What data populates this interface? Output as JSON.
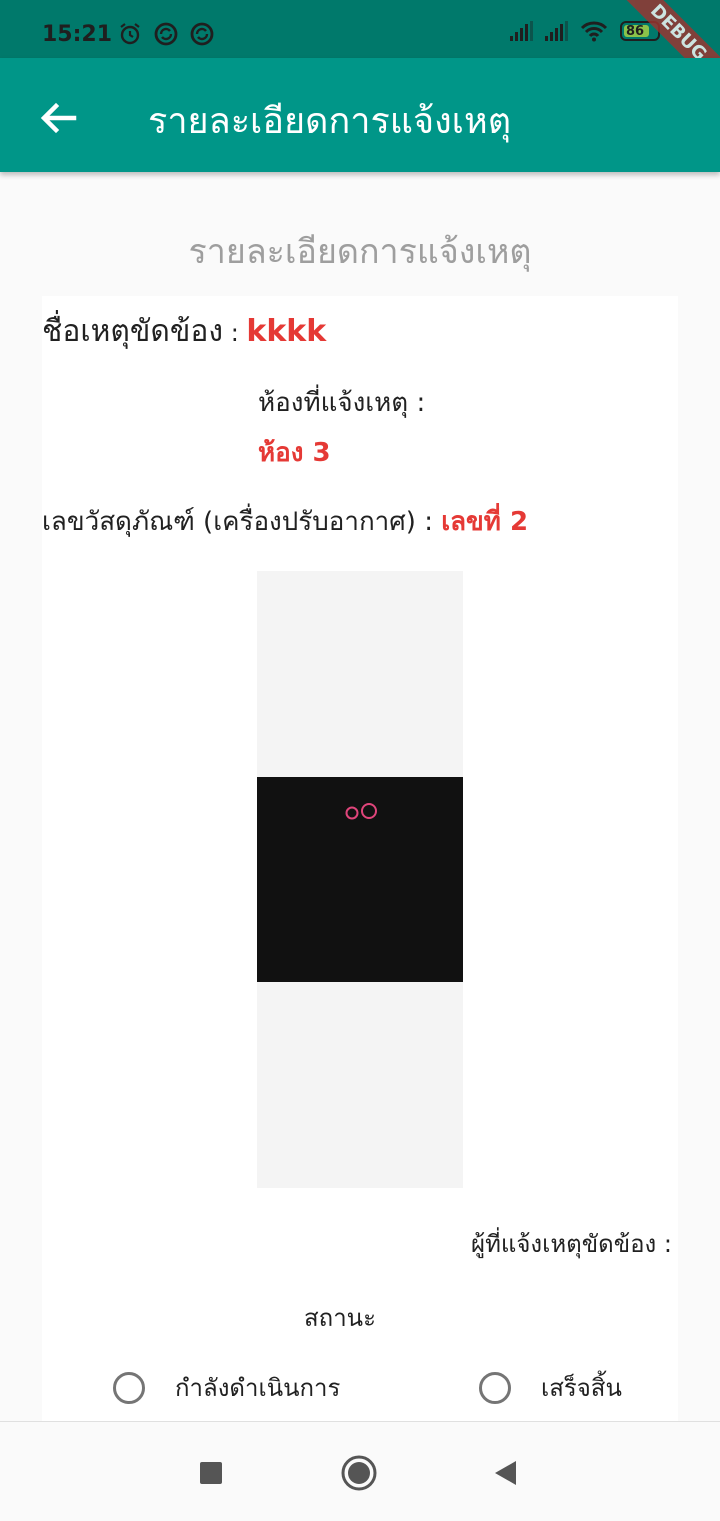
{
  "status_bar": {
    "time": "15:21",
    "icons_left": [
      "alarm-icon",
      "sync-icon",
      "sync-icon"
    ],
    "icons_right": [
      "signal-icon",
      "signal-icon",
      "wifi-icon",
      "battery-icon"
    ],
    "battery_level": "86",
    "debug_label": "DEBUG"
  },
  "app_bar": {
    "title": "รายละเอียดการแจ้งเหตุ",
    "back_icon": "arrow-back-icon",
    "background": "#009688"
  },
  "page": {
    "heading": "รายละเอียดการแจ้งเหตุ"
  },
  "details": {
    "issue_label": "ชื่อเหตุขัดข้อง",
    "separator": " : ",
    "issue_value": "kkkk",
    "room_label": "ห้องที่แจ้งเหตุ :",
    "room_value": "ห้อง 3",
    "asset_label": "เลขวัสดุภัณฑ์ (เครื่องปรับอากาศ) :",
    "asset_value": "เลขที่ 2",
    "reporter_label": "ผู้ที่แจ้งเหตุขัดข้อง :"
  },
  "status": {
    "label": "สถานะ",
    "options": [
      {
        "label": "กำลังดำเนินการ",
        "selected": false
      },
      {
        "label": "เสร็จสิ้น",
        "selected": false
      }
    ]
  },
  "nav_bar": {
    "buttons": [
      "recents-square-icon",
      "home-circle-icon",
      "back-triangle-icon"
    ]
  },
  "colors": {
    "accent": "#009688",
    "status_bar": "#00796b",
    "value_red": "#e53935"
  }
}
